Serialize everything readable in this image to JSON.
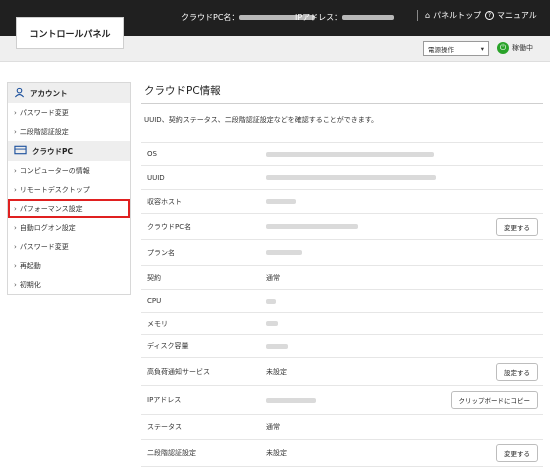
{
  "header": {
    "logo": "コントロールパネル",
    "pc_name_label": "クラウドPC名：",
    "ip_label": "IPアドレス：",
    "panel_top": "パネルトップ",
    "manual": "マニュアル",
    "power_select": "電源操作",
    "status": "稼働中"
  },
  "sidebar": {
    "account": "アカウント",
    "account_items": [
      "パスワード変更",
      "二段階認証設定"
    ],
    "cloudpc": "クラウドPC",
    "cloudpc_items": [
      "コンピューターの情報",
      "リモートデスクトップ",
      "パフォーマンス設定",
      "自動ログオン設定",
      "パスワード変更",
      "再起動",
      "初期化"
    ]
  },
  "main": {
    "title": "クラウドPC情報",
    "description": "UUID、契約ステータス、二段階認証設定などを確認することができます。",
    "rows": [
      {
        "label": "OS",
        "value": ""
      },
      {
        "label": "UUID",
        "value": ""
      },
      {
        "label": "収容ホスト",
        "value": ""
      },
      {
        "label": "クラウドPC名",
        "value": "",
        "button": "変更する"
      },
      {
        "label": "プラン名",
        "value": ""
      },
      {
        "label": "契約",
        "value": "通常"
      },
      {
        "label": "CPU",
        "value": ""
      },
      {
        "label": "メモリ",
        "value": ""
      },
      {
        "label": "ディスク容量",
        "value": ""
      },
      {
        "label": "高負荷通知サービス",
        "value": "未設定",
        "button": "設定する"
      },
      {
        "label": "IPアドレス",
        "value": "",
        "button": "クリップボードにコピー"
      },
      {
        "label": "ステータス",
        "value": "通常"
      },
      {
        "label": "二段階認証設定",
        "value": "未設定",
        "button": "変更する"
      }
    ]
  },
  "colors": {
    "topbar": "#202020",
    "highlight": "#e02020",
    "status_green": "#2aa32a"
  }
}
